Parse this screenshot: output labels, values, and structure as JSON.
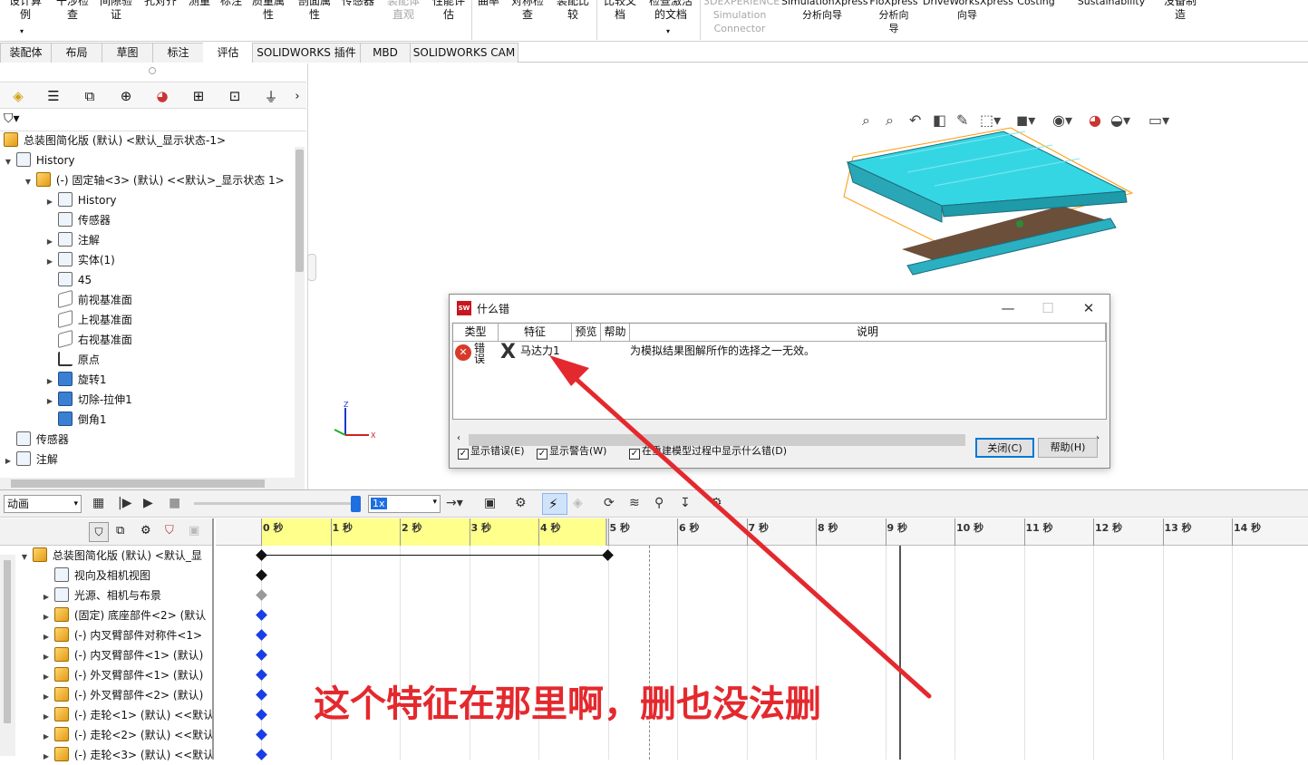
{
  "ribbon": {
    "items": [
      {
        "label": "设计算\n例"
      },
      {
        "label": "干涉检\n查"
      },
      {
        "label": "间隙验\n证"
      },
      {
        "label": "孔对齐"
      },
      {
        "label": "测量"
      },
      {
        "label": "标注"
      },
      {
        "label": "质量属\n性"
      },
      {
        "label": "剖面属\n性"
      },
      {
        "label": "传感器"
      },
      {
        "label": "装配体\n直观",
        "disabled": true
      },
      {
        "label": "性能评\n估"
      },
      {
        "label": "曲率"
      },
      {
        "label": "对称检\n查"
      },
      {
        "label": "装配比\n较"
      },
      {
        "label": "比较文\n档"
      },
      {
        "label": "检查激活\n的文档"
      },
      {
        "label": "3DEXPERIENCE\nSimulation\nConnector",
        "disabled": true
      },
      {
        "label": "SimulationXpress\n分析向导"
      },
      {
        "label": "FloXpress\n分析向\n导"
      },
      {
        "label": "DriveWorksXpress\n向导"
      },
      {
        "label": "Costing"
      },
      {
        "label": "Sustainability"
      },
      {
        "label": "没备制\n造"
      }
    ]
  },
  "cmd_tabs": [
    "装配体",
    "布局",
    "草图",
    "标注",
    "评估",
    "SOLIDWORKS 插件",
    "MBD",
    "SOLIDWORKS CAM"
  ],
  "active_tab": "评估",
  "feature_tree": {
    "root": "总装图简化版 (默认) <默认_显示状态-1>",
    "items": [
      {
        "label": "History"
      },
      {
        "label": "(-) 固定轴<3> (默认) <<默认>_显示状态 1>"
      },
      {
        "label": "History"
      },
      {
        "label": "传感器"
      },
      {
        "label": "注解"
      },
      {
        "label": "实体(1)"
      },
      {
        "label": "45"
      },
      {
        "label": "前视基准面"
      },
      {
        "label": "上视基准面"
      },
      {
        "label": "右视基准面"
      },
      {
        "label": "原点"
      },
      {
        "label": "旋转1"
      },
      {
        "label": "切除-拉伸1"
      },
      {
        "label": "倒角1"
      },
      {
        "label": "传感器"
      },
      {
        "label": "注解"
      }
    ]
  },
  "dialog": {
    "title": "什么错",
    "columns": [
      "类型",
      "特征",
      "预览",
      "帮助",
      "说明"
    ],
    "row": {
      "type": "错误",
      "feature": "马达力1",
      "desc": "为模拟结果图解所作的选择之一无效。"
    },
    "checks": [
      {
        "label": "显示错误(E)",
        "checked": true
      },
      {
        "label": "显示警告(W)",
        "checked": true
      },
      {
        "label": "在重建模型过程中显示什么错(D)",
        "checked": true
      }
    ],
    "close_label": "关闭(C)",
    "help_label": "帮助(H)"
  },
  "motion": {
    "study_type": "动画",
    "speed": "1x",
    "tree": [
      {
        "label": "总装图简化版 (默认) <默认_显"
      },
      {
        "label": "视向及相机视图"
      },
      {
        "label": "光源、相机与布景"
      },
      {
        "label": "(固定) 底座部件<2> (默认"
      },
      {
        "label": "(-) 内叉臂部件对称件<1>"
      },
      {
        "label": "(-) 内叉臂部件<1> (默认)"
      },
      {
        "label": "(-) 外叉臂部件<1> (默认)"
      },
      {
        "label": "(-) 外叉臂部件<2> (默认)"
      },
      {
        "label": "(-) 走轮<1> (默认) <<默认"
      },
      {
        "label": "(-) 走轮<2> (默认) <<默认"
      },
      {
        "label": "(-) 走轮<3> (默认) <<默认"
      }
    ],
    "ticks": [
      "0 秒",
      "1 秒",
      "2 秒",
      "3 秒",
      "4 秒",
      "5 秒",
      "6 秒",
      "7 秒",
      "8 秒",
      "9 秒",
      "10 秒",
      "11 秒",
      "12 秒",
      "13 秒",
      "14 秒"
    ]
  },
  "annotation": "这个特征在那里啊，删也没法删",
  "colors": {
    "annotation": "#e4292e",
    "model": "#2ec9d6",
    "selection": "#ff9900",
    "key_blue": "#1a3ee6"
  }
}
